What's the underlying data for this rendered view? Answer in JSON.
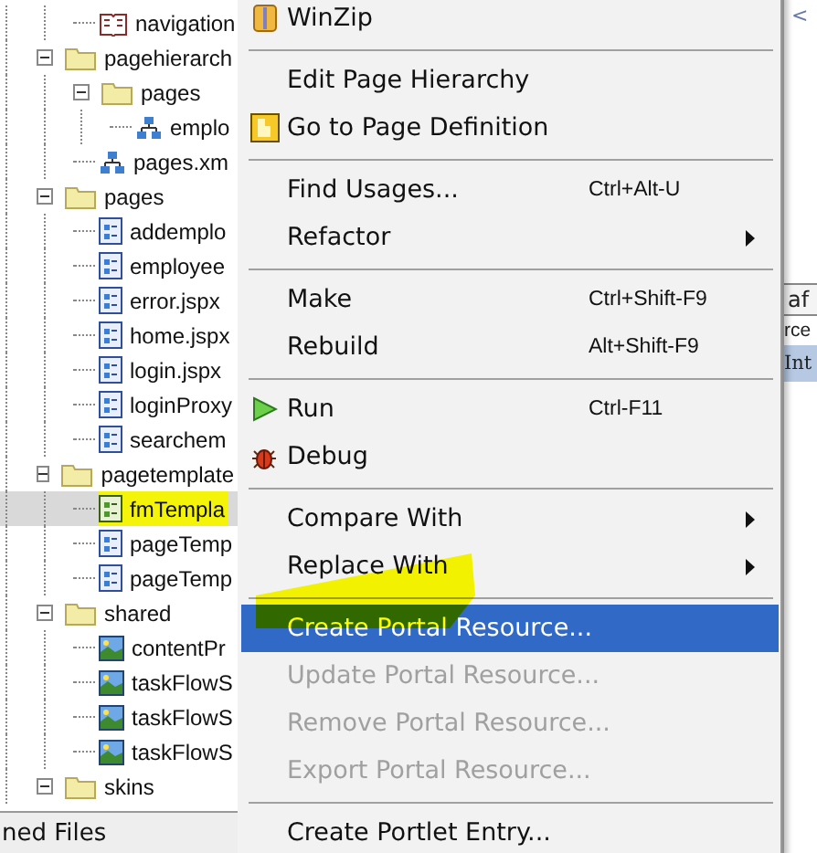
{
  "tree": {
    "items": [
      {
        "children": [
          {
            "label": "navigation",
            "kind": "book",
            "selected": false,
            "highlighted": false
          }
        ]
      },
      {
        "label": "pagehierarch",
        "kind": "folder",
        "expanded": true,
        "selected": false,
        "highlighted": false,
        "children": [
          {
            "label": "pages",
            "kind": "folder",
            "expanded": true,
            "selected": false,
            "highlighted": false,
            "children": [
              {
                "label": "emplo",
                "kind": "hierarchy",
                "selected": false,
                "highlighted": false
              }
            ]
          },
          {
            "label": "pages.xm",
            "kind": "hierarchy",
            "selected": false,
            "highlighted": false
          }
        ]
      },
      {
        "label": "pages",
        "kind": "folder",
        "expanded": true,
        "selected": false,
        "highlighted": false,
        "children": [
          {
            "label": "addemplo",
            "kind": "page",
            "selected": false,
            "highlighted": false
          },
          {
            "label": "employee",
            "kind": "page",
            "selected": false,
            "highlighted": false
          },
          {
            "label": "error.jspx",
            "kind": "page",
            "selected": false,
            "highlighted": false
          },
          {
            "label": "home.jspx",
            "kind": "page",
            "selected": false,
            "highlighted": false
          },
          {
            "label": "login.jspx",
            "kind": "page",
            "selected": false,
            "highlighted": false
          },
          {
            "label": "loginProxy",
            "kind": "page",
            "selected": false,
            "highlighted": false
          },
          {
            "label": "searchem",
            "kind": "page",
            "selected": false,
            "highlighted": false
          }
        ]
      },
      {
        "label": "pagetemplate",
        "kind": "folder",
        "expanded": true,
        "selected": false,
        "highlighted": false,
        "children": [
          {
            "label": "fmTempla",
            "kind": "template",
            "selected": true,
            "highlighted": true
          },
          {
            "label": "pageTemp",
            "kind": "page",
            "selected": false,
            "highlighted": false
          },
          {
            "label": "pageTemp",
            "kind": "page",
            "selected": false,
            "highlighted": false
          }
        ]
      },
      {
        "label": "shared",
        "kind": "folder",
        "expanded": true,
        "selected": false,
        "highlighted": false,
        "children": [
          {
            "label": "contentPr",
            "kind": "image",
            "selected": false,
            "highlighted": false
          },
          {
            "label": "taskFlowS",
            "kind": "image",
            "selected": false,
            "highlighted": false
          },
          {
            "label": "taskFlowS",
            "kind": "image",
            "selected": false,
            "highlighted": false
          },
          {
            "label": "taskFlowS",
            "kind": "image",
            "selected": false,
            "highlighted": false
          }
        ]
      },
      {
        "label": "skins",
        "kind": "folder",
        "expanded": true,
        "selected": false,
        "highlighted": false
      }
    ]
  },
  "bottom_tab": "ned Files",
  "editor": {
    "top_text": "<",
    "tab": "af",
    "line": "rce",
    "bar": "Int"
  },
  "context_menu": {
    "items": [
      {
        "kind": "winzip",
        "label": "WinZip",
        "selected": false,
        "disabled": false
      },
      {
        "kind": "separator"
      },
      {
        "kind": "item",
        "label": "Edit Page Hierarchy",
        "selected": false,
        "disabled": false
      },
      {
        "kind": "page-definition",
        "label": "Go to Page Definition",
        "selected": false,
        "disabled": false
      },
      {
        "kind": "separator"
      },
      {
        "kind": "item",
        "label": "Find Usages...",
        "shortcut": "Ctrl+Alt-U",
        "selected": false,
        "disabled": false
      },
      {
        "kind": "item",
        "label": "Refactor",
        "submenu": true,
        "selected": false,
        "disabled": false
      },
      {
        "kind": "separator"
      },
      {
        "kind": "item",
        "label": "Make",
        "shortcut": "Ctrl+Shift-F9",
        "selected": false,
        "disabled": false
      },
      {
        "kind": "item",
        "label": "Rebuild",
        "shortcut": "Alt+Shift-F9",
        "selected": false,
        "disabled": false
      },
      {
        "kind": "separator"
      },
      {
        "kind": "run",
        "label": "Run",
        "shortcut": "Ctrl-F11",
        "selected": false,
        "disabled": false
      },
      {
        "kind": "debug",
        "label": "Debug",
        "selected": false,
        "disabled": false
      },
      {
        "kind": "separator"
      },
      {
        "kind": "item",
        "label": "Compare With",
        "submenu": true,
        "selected": false,
        "disabled": false
      },
      {
        "kind": "item",
        "label": "Replace With",
        "submenu": true,
        "selected": false,
        "disabled": false
      },
      {
        "kind": "separator"
      },
      {
        "kind": "item",
        "label": "Create Portal Resource...",
        "selected": true,
        "disabled": false
      },
      {
        "kind": "item",
        "label": "Update Portal Resource...",
        "selected": false,
        "disabled": true
      },
      {
        "kind": "item",
        "label": "Remove Portal Resource...",
        "selected": false,
        "disabled": true
      },
      {
        "kind": "item",
        "label": "Export Portal Resource...",
        "selected": false,
        "disabled": true
      },
      {
        "kind": "separator"
      },
      {
        "kind": "item",
        "label": "Create Portlet Entry...",
        "selected": false,
        "disabled": false
      }
    ]
  }
}
